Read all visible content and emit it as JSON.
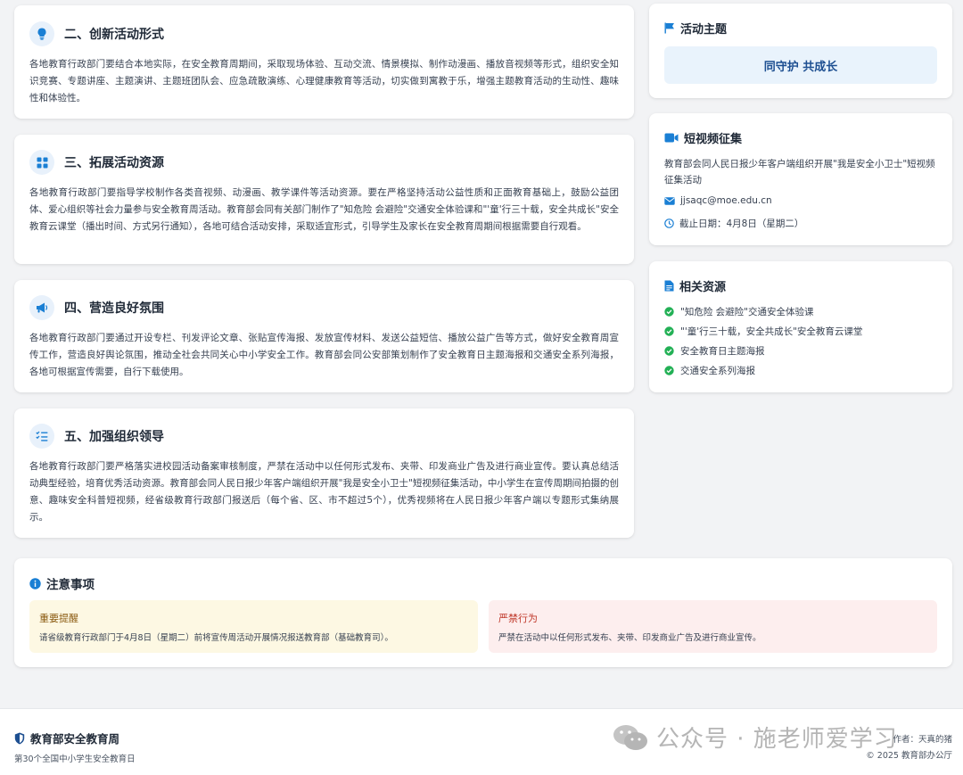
{
  "sections": [
    {
      "title": "二、创新活动形式",
      "icon": "lightbulb-icon",
      "body": "各地教育行政部门要结合本地实际，在安全教育周期间，采取现场体验、互动交流、情景模拟、制作动漫画、播放音视频等形式，组织安全知识竞赛、专题讲座、主题演讲、主题班团队会、应急疏散演练、心理健康教育等活动，切实做到寓教于乐，增强主题教育活动的生动性、趣味性和体验性。"
    },
    {
      "title": "三、拓展活动资源",
      "icon": "puzzle-icon",
      "body": "各地教育行政部门要指导学校制作各类音视频、动漫画、教学课件等活动资源。要在严格坚持活动公益性质和正面教育基础上，鼓励公益团体、爱心组织等社会力量参与安全教育周活动。教育部会同有关部门制作了\"知危险 会避险\"交通安全体验课和\"'童'行三十载，安全共成长\"安全教育云课堂（播出时间、方式另行通知），各地可结合活动安排，采取适宜形式，引导学生及家长在安全教育周期间根据需要自行观看。"
    },
    {
      "title": "四、营造良好氛围",
      "icon": "megaphone-icon",
      "body": "各地教育行政部门要通过开设专栏、刊发评论文章、张贴宣传海报、发放宣传材料、发送公益短信、播放公益广告等方式，做好安全教育周宣传工作，营造良好舆论氛围，推动全社会共同关心中小学安全工作。教育部会同公安部策划制作了安全教育日主题海报和交通安全系列海报，各地可根据宣传需要，自行下载使用。"
    },
    {
      "title": "五、加强组织领导",
      "icon": "list-check-icon",
      "body": "各地教育行政部门要严格落实进校园活动备案审核制度，严禁在活动中以任何形式发布、夹带、印发商业广告及进行商业宣传。要认真总结活动典型经验，培育优秀活动资源。教育部会同人民日报少年客户端组织开展\"我是安全小卫士\"短视频征集活动，中小学生在宣传周期间拍摄的创意、趣味安全科普短视频，经省级教育行政部门报送后（每个省、区、市不超过5个），优秀视频将在人民日报少年客户端以专题形式集纳展示。"
    }
  ],
  "sidebar": {
    "theme": {
      "title": "活动主题",
      "icon": "flag-icon",
      "value": "同守护 共成长"
    },
    "video": {
      "title": "短视频征集",
      "icon": "video-camera-icon",
      "desc": "教育部会同人民日报少年客户端组织开展\"我是安全小卫士\"短视频征集活动",
      "email": "jjsaqc@moe.edu.cn",
      "deadline": "截止日期：4月8日（星期二）"
    },
    "resources": {
      "title": "相关资源",
      "icon": "document-icon",
      "items": [
        "\"知危险 会避险\"交通安全体验课",
        "\"'童'行三十载，安全共成长\"安全教育云课堂",
        "安全教育日主题海报",
        "交通安全系列海报"
      ]
    }
  },
  "notice": {
    "title": "注意事项",
    "important": {
      "title": "重要提醒",
      "text": "请省级教育行政部门于4月8日（星期二）前将宣传周活动开展情况报送教育部（基础教育司）。"
    },
    "forbidden": {
      "title": "严禁行为",
      "text": "严禁在活动中以任何形式发布、夹带、印发商业广告及进行商业宣传。"
    }
  },
  "footer": {
    "brand": "教育部安全教育周",
    "subtitle": "第30个全国中小学生安全教育日",
    "author": "作者：天真的猪",
    "copyright": "© 2025 教育部办公厅",
    "watermark": "公众号 · 施老师爱学习"
  },
  "colors": {
    "accent": "#1a7fd4",
    "success": "#22b055",
    "warn_bg": "#fdf8e3",
    "warn_text": "#8a5a10",
    "danger_bg": "#fdeeee",
    "danger_text": "#c0392b"
  }
}
